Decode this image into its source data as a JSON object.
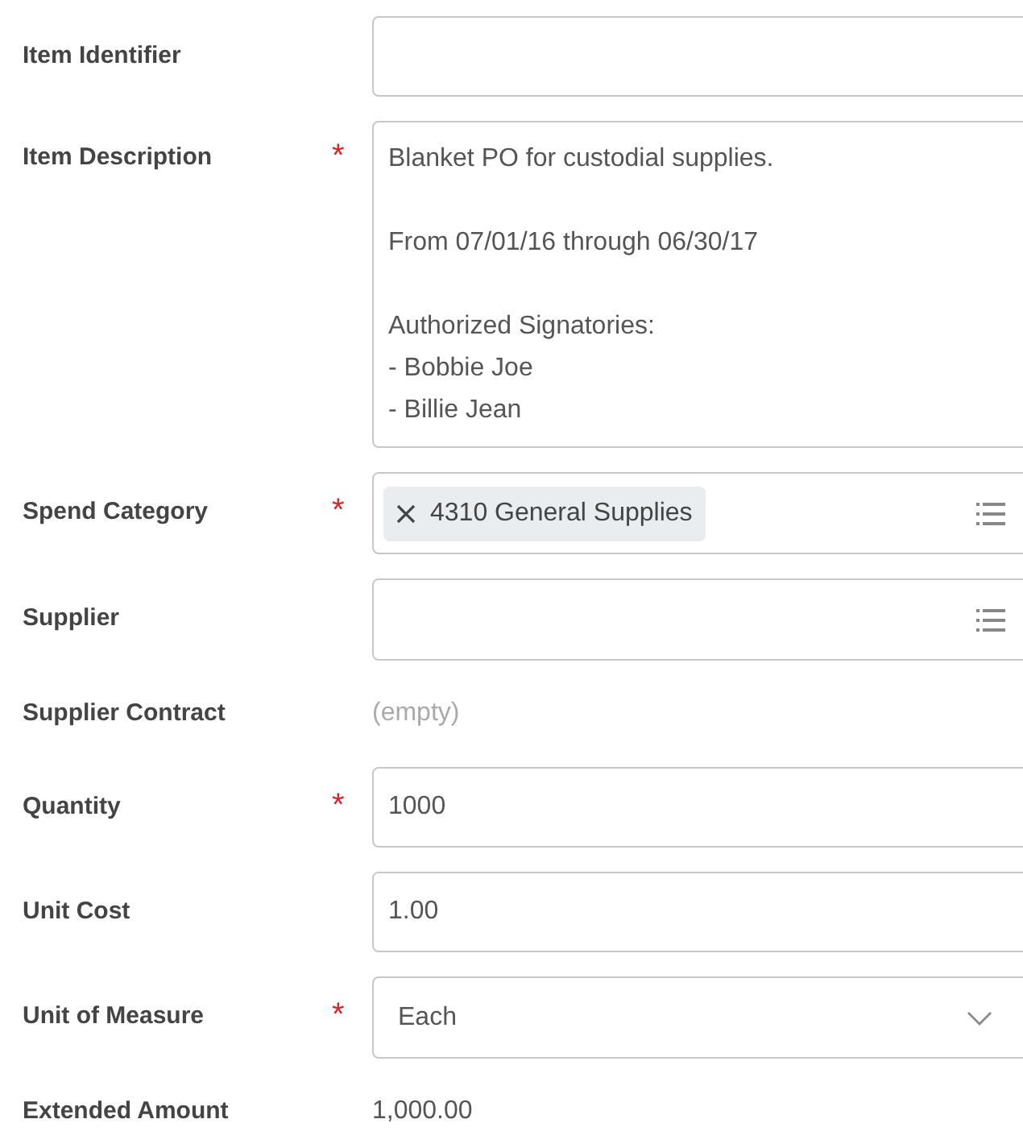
{
  "fields": [
    {
      "kind": "text",
      "label": "Item Identifier"
    },
    {
      "kind": "textarea",
      "label": "Item Description",
      "required_mark": "*",
      "value": "Blanket PO for custodial supplies.\n\nFrom 07/01/16 through 06/30/17\n\nAuthorized Signatories:\n- Bobbie Joe\n- Billie Jean"
    },
    {
      "kind": "prompt",
      "label": "Spend Category",
      "required_mark": "*",
      "chips": [
        "4310 General Supplies"
      ]
    },
    {
      "kind": "prompt",
      "label": "Supplier"
    },
    {
      "kind": "readonly",
      "label": "Supplier Contract",
      "placeholder": "(empty)"
    },
    {
      "kind": "text",
      "label": "Quantity",
      "required_mark": "*",
      "value": "1000"
    },
    {
      "kind": "text",
      "label": "Unit Cost",
      "value": "1.00"
    },
    {
      "kind": "select",
      "label": "Unit of Measure",
      "required_mark": "*",
      "value": "Each"
    },
    {
      "kind": "readonly",
      "label": "Extended Amount",
      "value": "1,000.00"
    }
  ]
}
